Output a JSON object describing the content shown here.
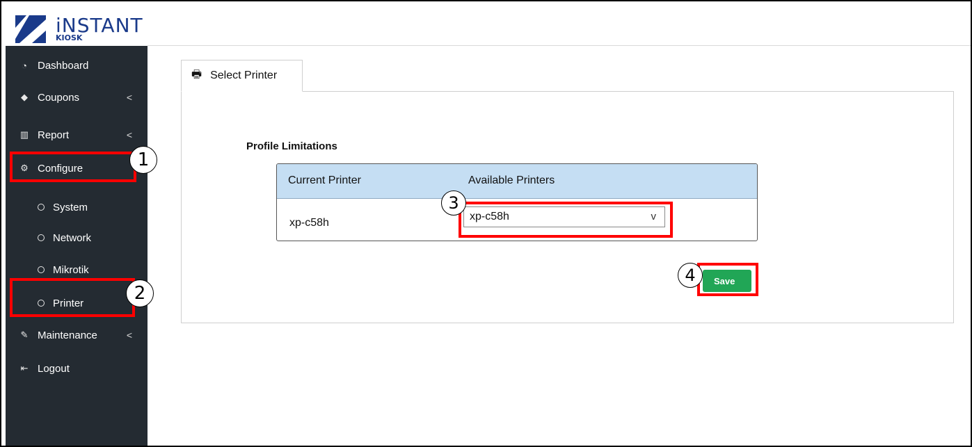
{
  "brand": {
    "name": "iNSTANT",
    "sub": "KIOSK"
  },
  "sidebar": {
    "items": [
      {
        "label": "Dashboard",
        "icon": "gauge-icon"
      },
      {
        "label": "Coupons",
        "icon": "tag-icon"
      },
      {
        "label": "Report",
        "icon": "bar-chart-icon"
      },
      {
        "label": "Configure",
        "icon": "gear-icon"
      },
      {
        "label": "System"
      },
      {
        "label": "Network"
      },
      {
        "label": "Mikrotik"
      },
      {
        "label": "Printer"
      },
      {
        "label": "Maintenance",
        "icon": "wrench-icon"
      },
      {
        "label": "Logout",
        "icon": "logout-icon"
      }
    ]
  },
  "tab": {
    "label": "Select Printer",
    "icon": "printer-icon"
  },
  "main": {
    "section_title": "Profile Limitations",
    "table": {
      "headers": [
        "Current Printer",
        "Available Printers"
      ],
      "current_printer": "xp-c58h",
      "selected_printer": "xp-c58h"
    },
    "save_label": "Save"
  },
  "annotations": [
    "1",
    "2",
    "3",
    "4"
  ],
  "colors": {
    "sidebar": "#242b32",
    "table_header": "#c5def3",
    "save_button": "#21a656",
    "highlight": "#ff0000"
  }
}
